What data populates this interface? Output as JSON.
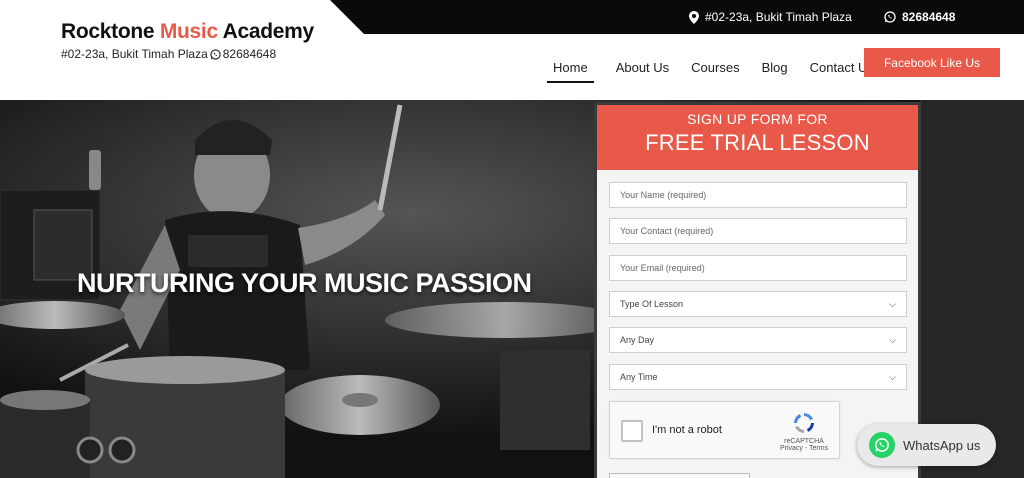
{
  "topbar": {
    "address": "#02-23a, Bukit Timah Plaza",
    "phone": "82684648"
  },
  "brand": {
    "name_part1": "Rocktone ",
    "name_accent": "Music",
    "name_part2": " Academy",
    "address": "#02-23a, Bukit Timah Plaza",
    "phone": "82684648"
  },
  "nav": {
    "items": [
      {
        "label": "Home"
      },
      {
        "label": "About Us"
      },
      {
        "label": "Courses"
      },
      {
        "label": "Blog"
      },
      {
        "label": "Contact Us"
      }
    ],
    "facebook_label": "Facebook Like Us"
  },
  "hero": {
    "headline": "NURTURING YOUR MUSIC PASSION"
  },
  "form": {
    "title_line1": "SIGN UP FORM FOR",
    "title_line2": "FREE TRIAL LESSON",
    "name_placeholder": "Your Name (required)",
    "contact_placeholder": "Your Contact (required)",
    "email_placeholder": "Your Email (required)",
    "lesson_select": "Type Of Lesson",
    "day_select": "Any Day",
    "time_select": "Any Time",
    "captcha_label": "I'm not a robot",
    "captcha_brand": "reCAPTCHA",
    "captcha_links": "Privacy - Terms"
  },
  "whatsapp": {
    "label": "WhatsApp us"
  },
  "colors": {
    "accent": "#e8594a",
    "topbar": "#0a0a0a",
    "whatsapp": "#25d366"
  }
}
